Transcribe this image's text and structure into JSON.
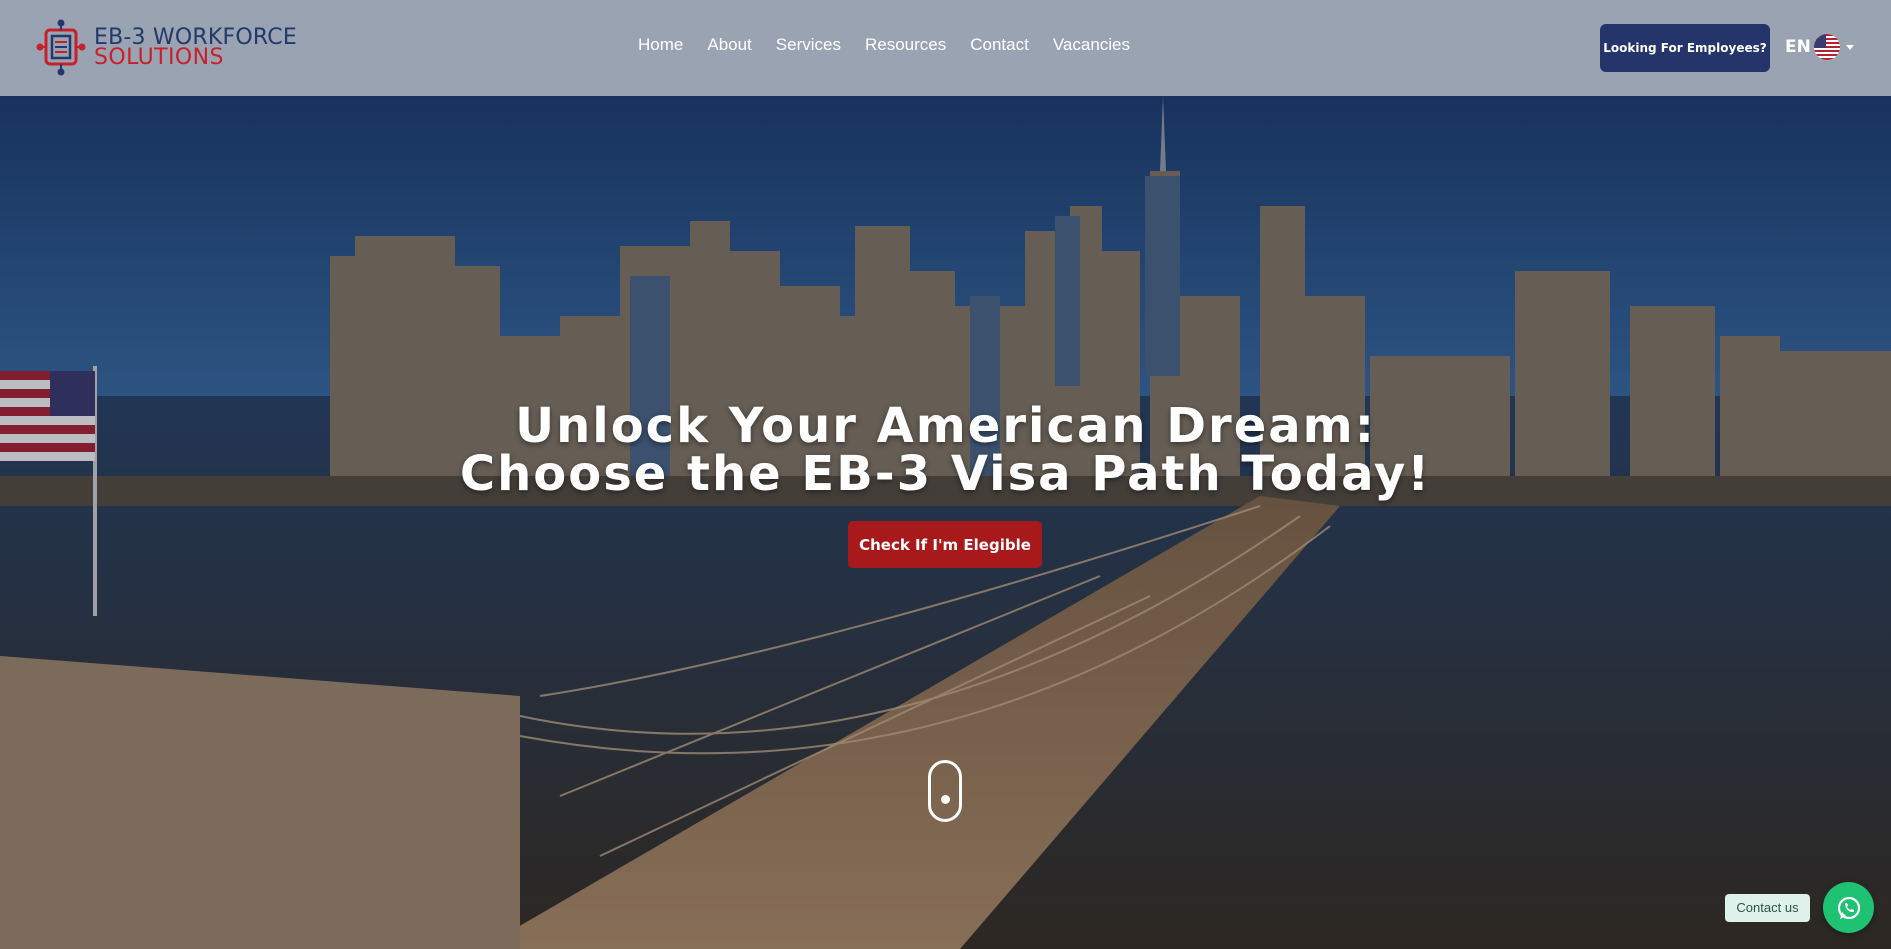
{
  "brand": {
    "line1": "EB-3 WORKFORCE",
    "line2": "SOLUTIONS",
    "colors": {
      "navy": "#23386b",
      "red": "#c8202a"
    }
  },
  "nav": {
    "items": [
      "Home",
      "About",
      "Services",
      "Resources",
      "Contact",
      "Vacancies"
    ]
  },
  "header": {
    "employer_button": "Looking For Employees?",
    "language": {
      "code": "EN",
      "flag_icon": "us-flag-icon"
    },
    "background": "#9aa3b1"
  },
  "hero": {
    "title_line1": "Unlock Your American Dream:",
    "title_line2": "Choose the EB-3 Visa Path Today!",
    "cta_label": "Check If I'm Elegible",
    "cta_color": "#a8191c",
    "scroll_icon": "mouse-scroll-icon"
  },
  "floating": {
    "contact_label": "Contact us",
    "whatsapp_icon": "whatsapp-icon",
    "whatsapp_color": "#1fc173"
  }
}
